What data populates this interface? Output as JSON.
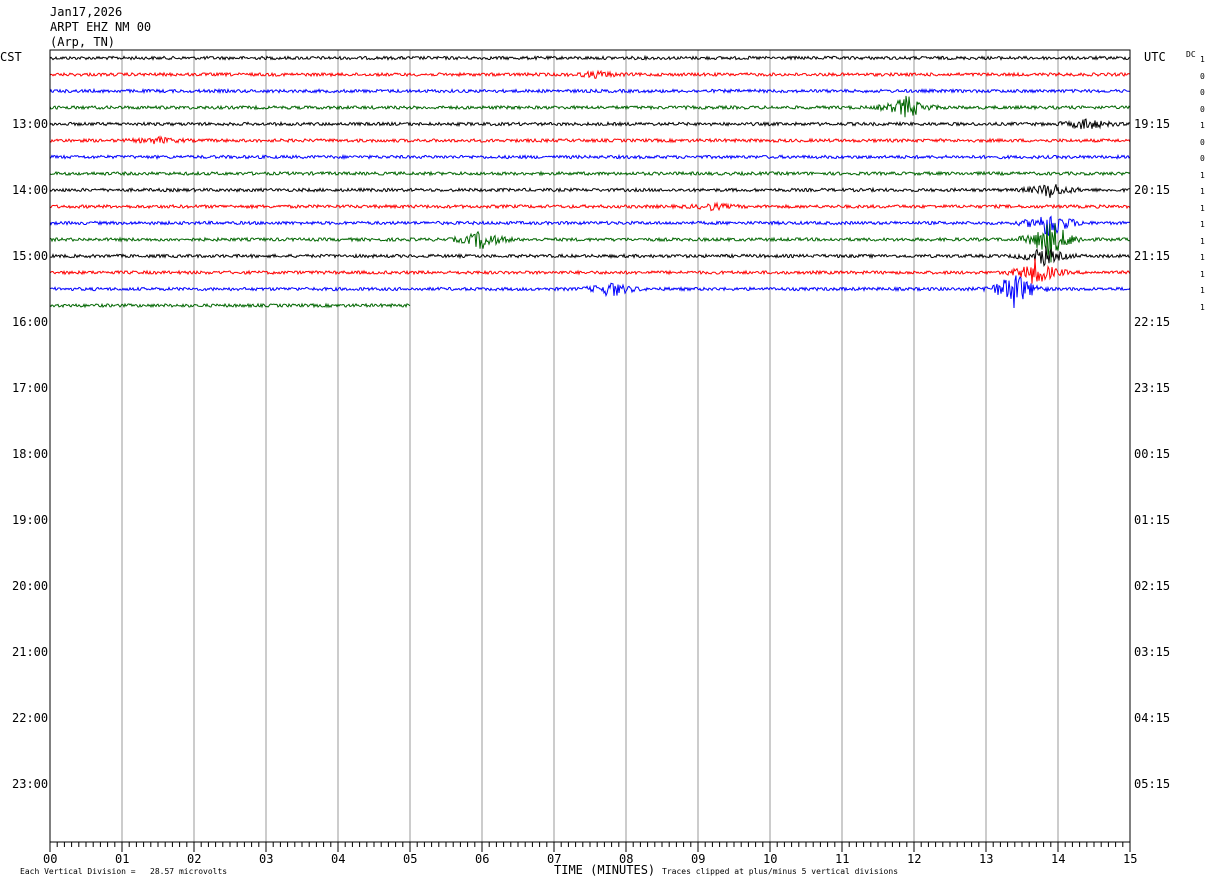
{
  "header": {
    "date": "Jan17,2026",
    "station": "ARPT EHZ NM 00",
    "location": "(Arp, TN)"
  },
  "labels": {
    "left_tz": "CST",
    "right_tz": "UTC",
    "dc": "DC",
    "xlabel": "TIME (MINUTES)",
    "scale_note": "Each Vertical Division =   28.57 microvolts",
    "clip_note": "Traces clipped at plus/minus 5 vertical divisions"
  },
  "chart_data": {
    "type": "line",
    "title": "Jan17,2026",
    "xlabel": "TIME (MINUTES)",
    "ylabel": "",
    "xlim": [
      0,
      15
    ],
    "x_ticks": [
      "00",
      "01",
      "02",
      "03",
      "04",
      "05",
      "06",
      "07",
      "08",
      "09",
      "10",
      "11",
      "12",
      "13",
      "14",
      "15"
    ],
    "left_hour_labels": [
      "13:00",
      "14:00",
      "15:00",
      "16:00",
      "17:00",
      "18:00",
      "19:00",
      "20:00",
      "21:00",
      "22:00",
      "23:00"
    ],
    "right_hour_labels": [
      "19:15",
      "20:15",
      "21:15",
      "22:15",
      "23:15",
      "00:15",
      "01:15",
      "02:15",
      "03:15",
      "04:15",
      "05:15"
    ],
    "trace_colors": [
      "#000000",
      "#ff0000",
      "#0000ff",
      "#006600"
    ],
    "dc_offsets": [
      "1",
      "0",
      "0",
      "0",
      "1",
      "0",
      "0",
      "1",
      "1",
      "1",
      "1",
      "1",
      "1",
      "1",
      "1",
      "1"
    ],
    "grid": "vertical lines every minute",
    "traces": [
      {
        "row": 0,
        "end_minute": 15,
        "events": []
      },
      {
        "row": 1,
        "end_minute": 15,
        "events": [
          {
            "minute": 7.6,
            "amp": 3
          }
        ]
      },
      {
        "row": 2,
        "end_minute": 15,
        "events": []
      },
      {
        "row": 3,
        "end_minute": 15,
        "events": [
          {
            "minute": 11.9,
            "amp": 12
          }
        ]
      },
      {
        "row": 4,
        "end_minute": 15,
        "events": [
          {
            "minute": 14.4,
            "amp": 6
          }
        ]
      },
      {
        "row": 5,
        "end_minute": 15,
        "events": [
          {
            "minute": 1.5,
            "amp": 3
          }
        ]
      },
      {
        "row": 6,
        "end_minute": 15,
        "events": []
      },
      {
        "row": 7,
        "end_minute": 15,
        "events": []
      },
      {
        "row": 8,
        "end_minute": 15,
        "events": [
          {
            "minute": 13.9,
            "amp": 8
          }
        ]
      },
      {
        "row": 9,
        "end_minute": 15,
        "events": [
          {
            "minute": 9.2,
            "amp": 3
          }
        ]
      },
      {
        "row": 10,
        "end_minute": 15,
        "events": [
          {
            "minute": 13.9,
            "amp": 16
          }
        ]
      },
      {
        "row": 11,
        "end_minute": 15,
        "events": [
          {
            "minute": 6.0,
            "amp": 10
          },
          {
            "minute": 13.9,
            "amp": 22
          }
        ]
      },
      {
        "row": 12,
        "end_minute": 15,
        "events": [
          {
            "minute": 13.8,
            "amp": 10
          }
        ]
      },
      {
        "row": 13,
        "end_minute": 15,
        "events": [
          {
            "minute": 13.7,
            "amp": 14
          }
        ]
      },
      {
        "row": 14,
        "end_minute": 15,
        "events": [
          {
            "minute": 7.8,
            "amp": 8
          },
          {
            "minute": 13.4,
            "amp": 20
          }
        ]
      },
      {
        "row": 15,
        "end_minute": 5,
        "events": []
      }
    ]
  }
}
